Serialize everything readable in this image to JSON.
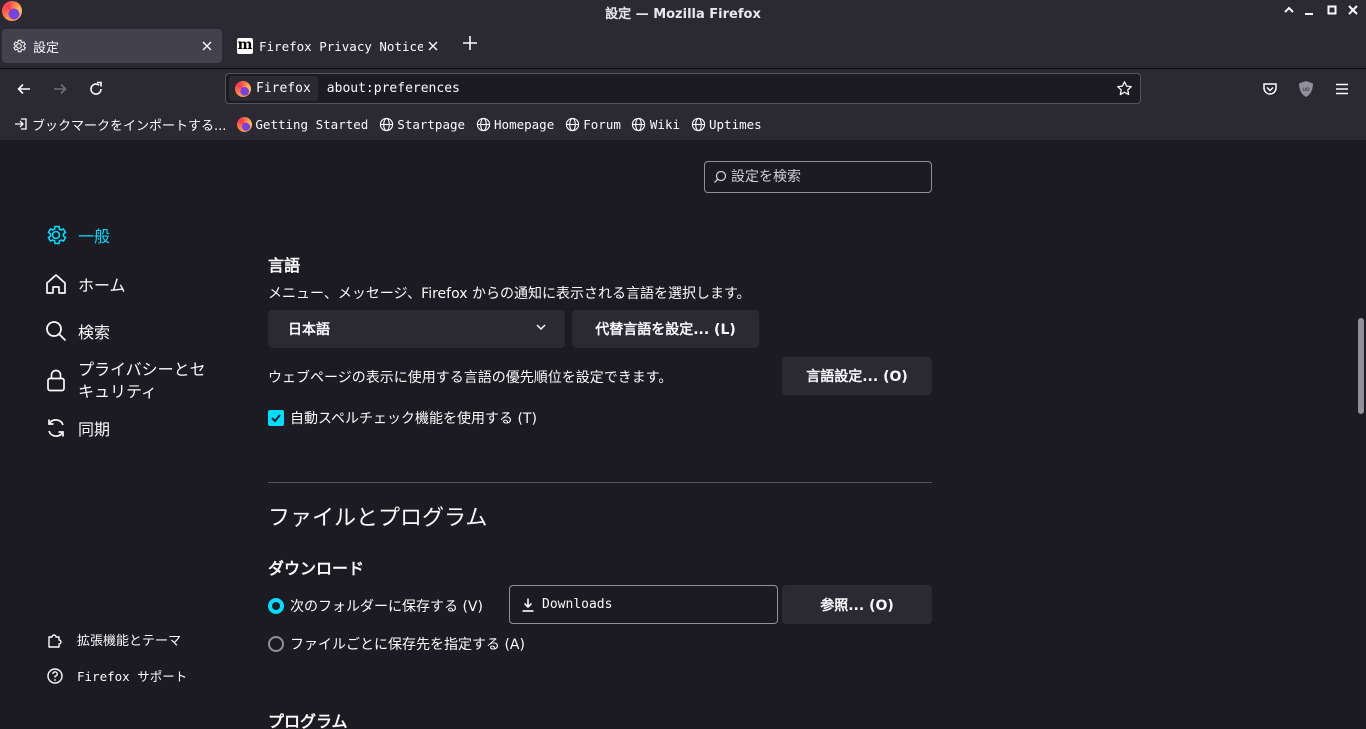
{
  "window": {
    "title": "設定 — Mozilla Firefox",
    "controls": [
      "minimize",
      "maximize",
      "close"
    ]
  },
  "tabs": [
    {
      "label": "設定",
      "icon": "gear-icon",
      "active": true
    },
    {
      "label": "Firefox Privacy Notice —",
      "icon": "mozilla-m-icon",
      "active": false
    }
  ],
  "navbar": {
    "identity_label": "Firefox",
    "url": "about:preferences"
  },
  "bookmarks": [
    {
      "label": "ブックマークをインポートする...",
      "icon": "import-icon"
    },
    {
      "label": "Getting Started",
      "icon": "firefox-icon"
    },
    {
      "label": "Startpage",
      "icon": "globe-icon"
    },
    {
      "label": "Homepage",
      "icon": "globe-icon"
    },
    {
      "label": "Forum",
      "icon": "globe-icon"
    },
    {
      "label": "Wiki",
      "icon": "globe-icon"
    },
    {
      "label": "Uptimes",
      "icon": "globe-icon"
    }
  ],
  "search": {
    "placeholder": "設定を検索"
  },
  "sidebar": {
    "categories": [
      {
        "label": "一般",
        "icon": "gear-icon",
        "selected": true
      },
      {
        "label": "ホーム",
        "icon": "home-icon",
        "selected": false
      },
      {
        "label": "検索",
        "icon": "search-icon",
        "selected": false
      },
      {
        "label_line1": "プライバシーとセ",
        "label_line2": "キュリティ",
        "icon": "lock-icon",
        "selected": false
      },
      {
        "label": "同期",
        "icon": "sync-icon",
        "selected": false
      }
    ],
    "footer": [
      {
        "label": "拡張機能とテーマ",
        "icon": "puzzle-icon"
      },
      {
        "label": "Firefox サポート",
        "icon": "help-icon"
      }
    ]
  },
  "language": {
    "heading": "言語",
    "description": "メニュー、メッセージ、Firefox からの通知に表示される言語を選択します。",
    "selected_language": "日本語",
    "alternatives_button": "代替言語を設定... (L)",
    "pages_description": "ウェブページの表示に使用する言語の優先順位を設定できます。",
    "choose_button": "言語設定... (O)",
    "spellcheck_label": "自動スペルチェック機能を使用する (T)",
    "spellcheck_checked": true
  },
  "files": {
    "heading": "ファイルとプログラム",
    "downloads_heading": "ダウンロード",
    "save_to_label": "次のフォルダーに保存する (V)",
    "save_to_selected": true,
    "folder_value": "Downloads",
    "browse_button": "参照... (O)",
    "always_ask_label": "ファイルごとに保存先を指定する (A)",
    "programs_heading": "プログラム"
  },
  "colors": {
    "accent": "#00ddff",
    "background": "#1c1b22",
    "toolbar": "#2b2a33",
    "button": "#2b2a33"
  }
}
